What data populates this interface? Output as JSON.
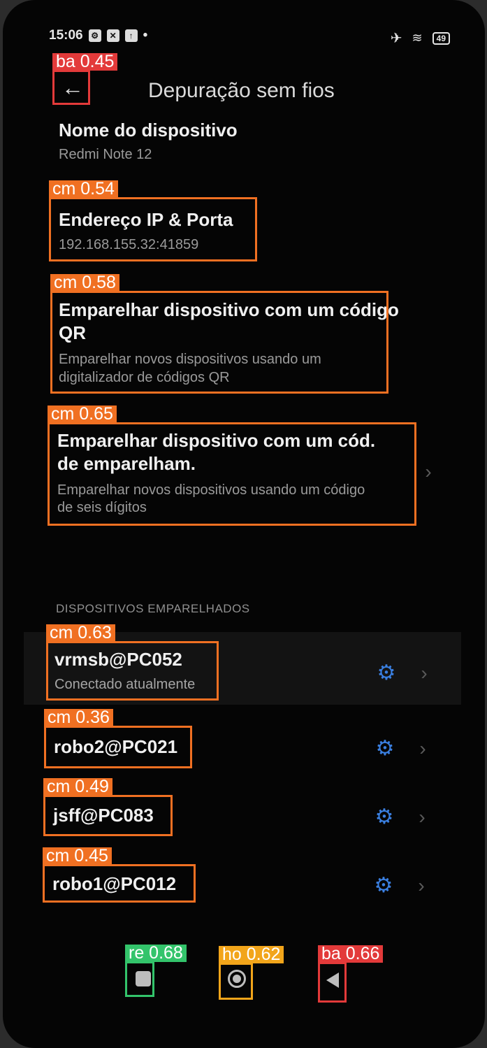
{
  "status_bar": {
    "time": "15:06",
    "dot": "•",
    "battery": "49"
  },
  "header": {
    "title": "Depuração sem fios"
  },
  "device_name": {
    "title": "Nome do dispositivo",
    "value": "Redmi Note 12"
  },
  "ip_port": {
    "title": "Endereço IP & Porta",
    "value": "192.168.155.32:41859"
  },
  "pair_qr": {
    "title_line1": "Emparelhar dispositivo com um código",
    "title_line2": "QR",
    "sub_line1": "Emparelhar novos dispositivos usando um",
    "sub_line2": "digitalizador de códigos QR"
  },
  "pair_code": {
    "title_line1": "Emparelhar dispositivo com um cód.",
    "title_line2": "de emparelham.",
    "sub_line1": "Emparelhar novos dispositivos usando um código",
    "sub_line2": "de seis dígitos"
  },
  "paired_section": {
    "header": "DISPOSITIVOS EMPARELHADOS",
    "devices": [
      {
        "name": "vrmsb@PC052",
        "status": "Conectado atualmente"
      },
      {
        "name": "robo2@PC021"
      },
      {
        "name": "jsff@PC083"
      },
      {
        "name": "robo1@PC012"
      }
    ]
  },
  "annotations": {
    "back_top": "ba 0.45",
    "ip": "cm 0.54",
    "qr": "cm 0.58",
    "code": "cm 0.65",
    "dev0": "cm 0.63",
    "dev1": "cm 0.36",
    "dev2": "cm 0.49",
    "dev3": "cm 0.45",
    "recents": "re 0.68",
    "home": "ho 0.62",
    "back_nav": "ba 0.66"
  },
  "icons": {
    "back": "arrow-left-icon",
    "settings": "gear-icon",
    "chevron": "chevron-right-icon"
  },
  "colors": {
    "background": "#050505",
    "accent": "#3a7fe0",
    "annotation_orange": "#f07022",
    "annotation_red": "#e33a3a",
    "annotation_green": "#33c46b",
    "annotation_yellow": "#f2a51a"
  }
}
